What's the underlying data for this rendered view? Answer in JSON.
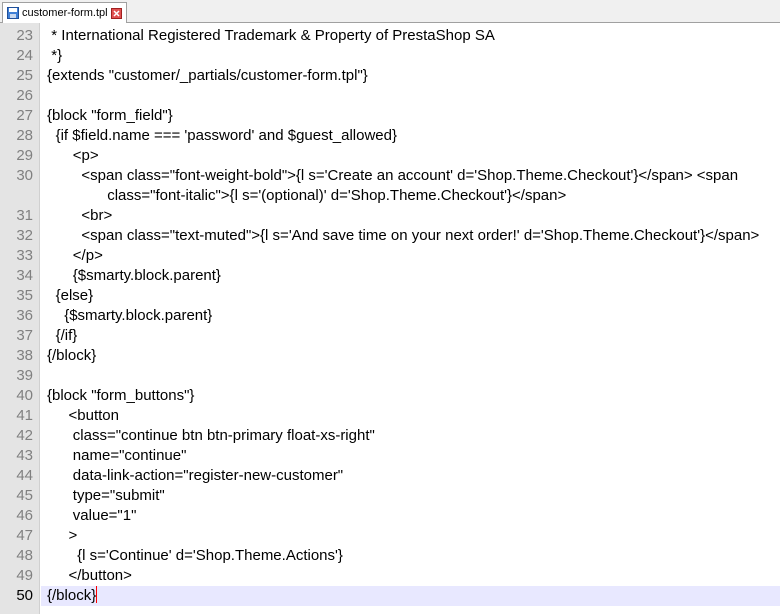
{
  "tab": {
    "label": "customer-form.tpl",
    "icon": "file-icon",
    "close_icon": "close-icon"
  },
  "editor": {
    "current_line": "50",
    "lines": [
      {
        "num": "23",
        "text": "* International Registered Trademark & Property of PrestaShop SA",
        "indent": 1
      },
      {
        "num": "24",
        "text": "*}",
        "indent": 1
      },
      {
        "num": "25",
        "text": "{extends \"customer/_partials/customer-form.tpl\"}",
        "indent": 0
      },
      {
        "num": "26",
        "text": "",
        "indent": 0
      },
      {
        "num": "27",
        "text": "{block \"form_field\"}",
        "indent": 0
      },
      {
        "num": "28",
        "text": "{if $field.name === 'password' and $guest_allowed}",
        "indent": 2
      },
      {
        "num": "29",
        "text": "<p>",
        "indent": 6
      },
      {
        "num": "30",
        "text": "<span class=\"font-weight-bold\">{l s='Create an account' d='Shop.Theme.Checkout'}</span> <span",
        "wrap": "class=\"font-italic\">{l s='(optional)' d='Shop.Theme.Checkout'}</span>",
        "indent": 8
      },
      {
        "num": "31",
        "text": "<br>",
        "indent": 8
      },
      {
        "num": "32",
        "text": "<span class=\"text-muted\">{l s='And save time on your next order!' d='Shop.Theme.Checkout'}</span>",
        "indent": 8
      },
      {
        "num": "33",
        "text": "</p>",
        "indent": 6
      },
      {
        "num": "34",
        "text": "{$smarty.block.parent}",
        "indent": 6
      },
      {
        "num": "35",
        "text": "{else}",
        "indent": 2
      },
      {
        "num": "36",
        "text": "{$smarty.block.parent}",
        "indent": 4
      },
      {
        "num": "37",
        "text": "{/if}",
        "indent": 2
      },
      {
        "num": "38",
        "text": "{/block}",
        "indent": 0
      },
      {
        "num": "39",
        "text": "",
        "indent": 0
      },
      {
        "num": "40",
        "text": "{block \"form_buttons\"}",
        "indent": 0
      },
      {
        "num": "41",
        "text": "<button",
        "indent": 5
      },
      {
        "num": "42",
        "text": "class=\"continue btn btn-primary float-xs-right\"",
        "indent": 6
      },
      {
        "num": "43",
        "text": "name=\"continue\"",
        "indent": 6
      },
      {
        "num": "44",
        "text": "data-link-action=\"register-new-customer\"",
        "indent": 6
      },
      {
        "num": "45",
        "text": "type=\"submit\"",
        "indent": 6
      },
      {
        "num": "46",
        "text": "value=\"1\"",
        "indent": 6
      },
      {
        "num": "47",
        "text": ">",
        "indent": 5
      },
      {
        "num": "48",
        "text": "{l s='Continue' d='Shop.Theme.Actions'}",
        "indent": 7
      },
      {
        "num": "49",
        "text": "</button>",
        "indent": 5
      },
      {
        "num": "50",
        "text": "{/block}",
        "indent": 0
      }
    ]
  }
}
